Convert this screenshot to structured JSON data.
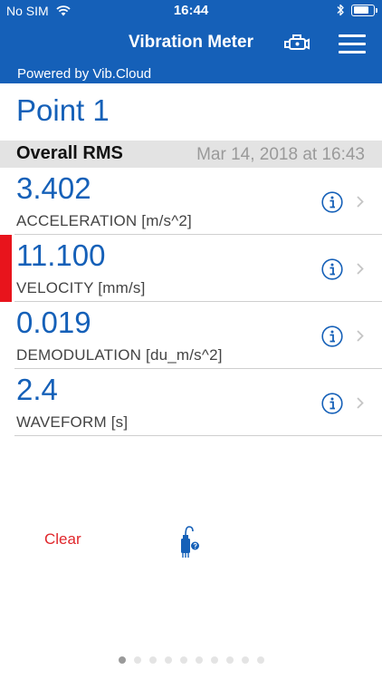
{
  "status_bar": {
    "carrier": "No SIM",
    "time": "16:44",
    "battery_level": 0.9,
    "icons": [
      "wifi-icon",
      "bluetooth-icon",
      "battery-icon"
    ]
  },
  "nav": {
    "title": "Vibration Meter",
    "icons": [
      "engine-icon",
      "menu-icon"
    ]
  },
  "powered_by": "Powered by Vib.Cloud",
  "point_title": "Point 1",
  "section": {
    "title": "Overall RMS",
    "date": "Mar 14, 2018 at 16:43"
  },
  "measurements": [
    {
      "value": "3.402",
      "label": "ACCELERATION [m/s^2]",
      "alert": false
    },
    {
      "value": "11.100",
      "label": "VELOCITY [mm/s]",
      "alert": true,
      "alert_color": "#e8141c"
    },
    {
      "value": "0.019",
      "label": "DEMODULATION [du_m/s^2]",
      "alert": false
    },
    {
      "value": "2.4",
      "label": "WAVEFORM [s]",
      "alert": false
    }
  ],
  "toolbar": {
    "clear_label": "Clear",
    "sensor_icon": "sensor-icon"
  },
  "pagination": {
    "total": 10,
    "current": 1
  },
  "colors": {
    "primary": "#1560b8",
    "alert": "#e8141c",
    "clear": "#e0262b"
  }
}
